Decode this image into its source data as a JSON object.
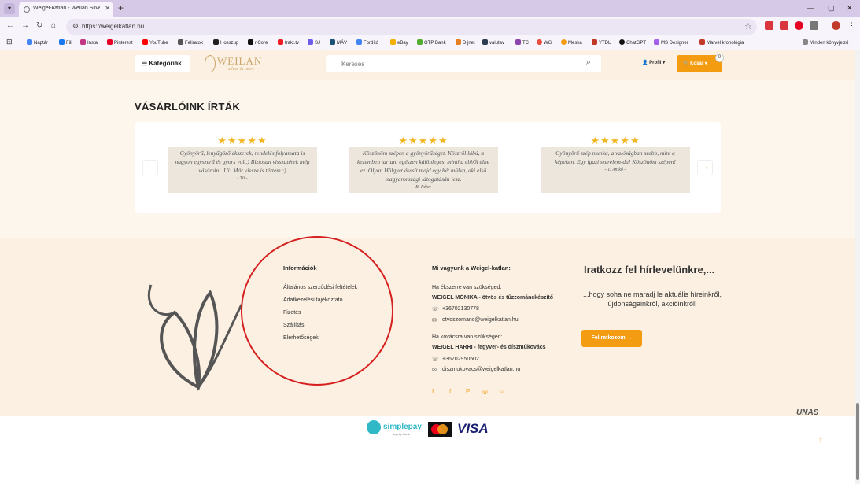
{
  "browser": {
    "tab_title": "Weigel-katlan - Weilan Silverfil",
    "url": "https://weigelkatlan.hu",
    "bookmarks": [
      "Naptár",
      "Fili",
      "Insta",
      "Pinterest",
      "YouTube",
      "Feliratok",
      "Hosszup",
      "nCore",
      "trakt.tv",
      "SJ",
      "MÁV",
      "Fordító",
      "eBay",
      "OTP Bank",
      "Díjnet",
      "valutav",
      "TC",
      "WG",
      "Meska",
      "YTDL",
      "ChatGPT",
      "MS Designer",
      "Marvel kronológia"
    ],
    "bookmarks_other": "Minden könyvjelző"
  },
  "header": {
    "categories_label": "Kategóriák",
    "logo_main": "WEILAN",
    "logo_sub": "silver & more",
    "search_placeholder": "Keresés",
    "profile_label": "Profil",
    "cart_label": "Kosár",
    "cart_count": "0"
  },
  "reviews": {
    "title": "VÁSÁRLÓINK ÍRTÁK",
    "items": [
      {
        "stars": "★★★★★",
        "text": "Gyönyörű, lenyűgöző ékszerek, rendelés folyamata is nagyon egyszerű és gyors volt.) Biztosan visszatérek még vásárolni. Ui: Már vissza is tértem :)",
        "author": "- Tü -"
      },
      {
        "stars": "★★★★★",
        "text": "Köszönöm szépen a gyönyörűséget. Köszről lábú, a kezemben tartani egészen különleges, mintha ebből élne ez. Olyan Hölgyet ékesít majd egy hét múlva, aki első magyarországi látogatásán lesz.",
        "author": "- B. Péter -"
      },
      {
        "stars": "★★★★★",
        "text": "Gyönyörű szép munka, a valóságban szebb, mint a képeken. Egy igazi szerelem-da! Köszönöm szépen!",
        "author": "- T. Anikó -"
      }
    ]
  },
  "footer": {
    "info_title": "Információk",
    "info_links": [
      "Általános szerződési feltételek",
      "Adatkezelési tájékoztató",
      "Fizetés",
      "Szállítás",
      "Elérhetőségek"
    ],
    "about_title": "Mi vagyunk a Weigel-katlan:",
    "jewel_intro": "Ha ékszerre van szükséged:",
    "jewel_name": "WEIGEL MÓNIKA - ötvös és tűzzománckészítő",
    "jewel_phone": "+36702130778",
    "jewel_email": "otvoszomanc@weigelkatlan.hu",
    "smith_intro": "Ha kovácsra van szükséged:",
    "smith_name": "WEIGEL HARRI - fegyver- és díszműkovács",
    "smith_phone": "+36702950502",
    "smith_email": "diszmukovacs@weigelkatlan.hu",
    "newsletter_title": "Iratkozz fel hírlevelünkre,...",
    "newsletter_text": "...hogy soha ne maradj le aktuális híreinkről, újdonságainkról, akcióinkról!",
    "subscribe_label": "Feliratkozom →"
  },
  "payments": {
    "simplepay": "simplepay",
    "simplepay_sub": "by otp bank",
    "visa": "VISA",
    "platform": "UNAS"
  },
  "colors": {
    "accent": "#f39c12",
    "background": "#fbf0e1",
    "highlight": "#d62020"
  }
}
